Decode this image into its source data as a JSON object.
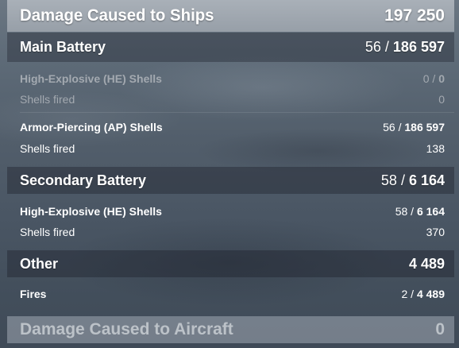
{
  "damage_ships": {
    "label": "Damage Caused to Ships",
    "value": "197 250"
  },
  "main_battery": {
    "label": "Main Battery",
    "hits": "56",
    "damage": "186 597",
    "he": {
      "label": "High-Explosive (HE) Shells",
      "hits": "0",
      "damage": "0",
      "fired_label": "Shells fired",
      "fired": "0"
    },
    "ap": {
      "label": "Armor-Piercing (AP) Shells",
      "hits": "56",
      "damage": "186 597",
      "fired_label": "Shells fired",
      "fired": "138"
    }
  },
  "secondary_battery": {
    "label": "Secondary Battery",
    "hits": "58",
    "damage": "6 164",
    "he": {
      "label": "High-Explosive (HE) Shells",
      "hits": "58",
      "damage": "6 164",
      "fired_label": "Shells fired",
      "fired": "370"
    }
  },
  "other": {
    "label": "Other",
    "value": "4 489",
    "fires": {
      "label": "Fires",
      "count": "2",
      "damage": "4 489"
    }
  },
  "damage_aircraft": {
    "label": "Damage Caused to Aircraft",
    "value": "0"
  }
}
